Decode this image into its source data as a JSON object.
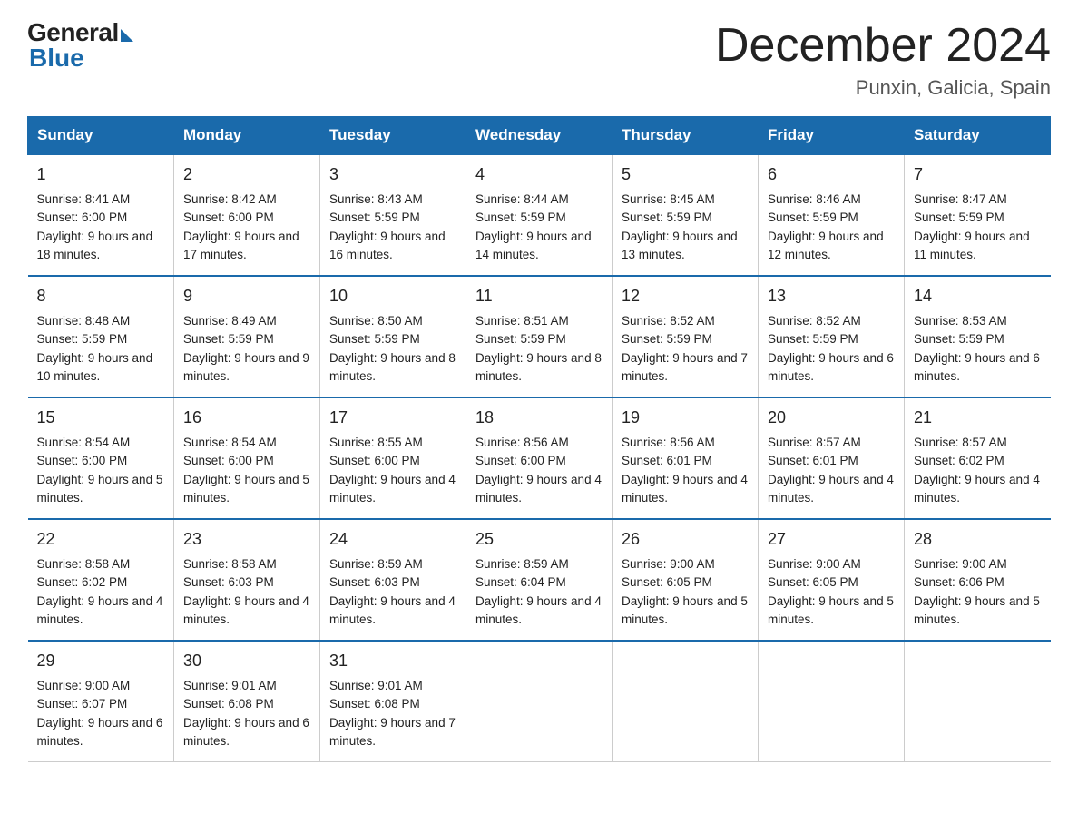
{
  "logo": {
    "general": "General",
    "blue": "Blue"
  },
  "header": {
    "title": "December 2024",
    "location": "Punxin, Galicia, Spain"
  },
  "days_header": [
    "Sunday",
    "Monday",
    "Tuesday",
    "Wednesday",
    "Thursday",
    "Friday",
    "Saturday"
  ],
  "weeks": [
    [
      {
        "day": "1",
        "sunrise": "8:41 AM",
        "sunset": "6:00 PM",
        "daylight": "9 hours and 18 minutes."
      },
      {
        "day": "2",
        "sunrise": "8:42 AM",
        "sunset": "6:00 PM",
        "daylight": "9 hours and 17 minutes."
      },
      {
        "day": "3",
        "sunrise": "8:43 AM",
        "sunset": "5:59 PM",
        "daylight": "9 hours and 16 minutes."
      },
      {
        "day": "4",
        "sunrise": "8:44 AM",
        "sunset": "5:59 PM",
        "daylight": "9 hours and 14 minutes."
      },
      {
        "day": "5",
        "sunrise": "8:45 AM",
        "sunset": "5:59 PM",
        "daylight": "9 hours and 13 minutes."
      },
      {
        "day": "6",
        "sunrise": "8:46 AM",
        "sunset": "5:59 PM",
        "daylight": "9 hours and 12 minutes."
      },
      {
        "day": "7",
        "sunrise": "8:47 AM",
        "sunset": "5:59 PM",
        "daylight": "9 hours and 11 minutes."
      }
    ],
    [
      {
        "day": "8",
        "sunrise": "8:48 AM",
        "sunset": "5:59 PM",
        "daylight": "9 hours and 10 minutes."
      },
      {
        "day": "9",
        "sunrise": "8:49 AM",
        "sunset": "5:59 PM",
        "daylight": "9 hours and 9 minutes."
      },
      {
        "day": "10",
        "sunrise": "8:50 AM",
        "sunset": "5:59 PM",
        "daylight": "9 hours and 8 minutes."
      },
      {
        "day": "11",
        "sunrise": "8:51 AM",
        "sunset": "5:59 PM",
        "daylight": "9 hours and 8 minutes."
      },
      {
        "day": "12",
        "sunrise": "8:52 AM",
        "sunset": "5:59 PM",
        "daylight": "9 hours and 7 minutes."
      },
      {
        "day": "13",
        "sunrise": "8:52 AM",
        "sunset": "5:59 PM",
        "daylight": "9 hours and 6 minutes."
      },
      {
        "day": "14",
        "sunrise": "8:53 AM",
        "sunset": "5:59 PM",
        "daylight": "9 hours and 6 minutes."
      }
    ],
    [
      {
        "day": "15",
        "sunrise": "8:54 AM",
        "sunset": "6:00 PM",
        "daylight": "9 hours and 5 minutes."
      },
      {
        "day": "16",
        "sunrise": "8:54 AM",
        "sunset": "6:00 PM",
        "daylight": "9 hours and 5 minutes."
      },
      {
        "day": "17",
        "sunrise": "8:55 AM",
        "sunset": "6:00 PM",
        "daylight": "9 hours and 4 minutes."
      },
      {
        "day": "18",
        "sunrise": "8:56 AM",
        "sunset": "6:00 PM",
        "daylight": "9 hours and 4 minutes."
      },
      {
        "day": "19",
        "sunrise": "8:56 AM",
        "sunset": "6:01 PM",
        "daylight": "9 hours and 4 minutes."
      },
      {
        "day": "20",
        "sunrise": "8:57 AM",
        "sunset": "6:01 PM",
        "daylight": "9 hours and 4 minutes."
      },
      {
        "day": "21",
        "sunrise": "8:57 AM",
        "sunset": "6:02 PM",
        "daylight": "9 hours and 4 minutes."
      }
    ],
    [
      {
        "day": "22",
        "sunrise": "8:58 AM",
        "sunset": "6:02 PM",
        "daylight": "9 hours and 4 minutes."
      },
      {
        "day": "23",
        "sunrise": "8:58 AM",
        "sunset": "6:03 PM",
        "daylight": "9 hours and 4 minutes."
      },
      {
        "day": "24",
        "sunrise": "8:59 AM",
        "sunset": "6:03 PM",
        "daylight": "9 hours and 4 minutes."
      },
      {
        "day": "25",
        "sunrise": "8:59 AM",
        "sunset": "6:04 PM",
        "daylight": "9 hours and 4 minutes."
      },
      {
        "day": "26",
        "sunrise": "9:00 AM",
        "sunset": "6:05 PM",
        "daylight": "9 hours and 5 minutes."
      },
      {
        "day": "27",
        "sunrise": "9:00 AM",
        "sunset": "6:05 PM",
        "daylight": "9 hours and 5 minutes."
      },
      {
        "day": "28",
        "sunrise": "9:00 AM",
        "sunset": "6:06 PM",
        "daylight": "9 hours and 5 minutes."
      }
    ],
    [
      {
        "day": "29",
        "sunrise": "9:00 AM",
        "sunset": "6:07 PM",
        "daylight": "9 hours and 6 minutes."
      },
      {
        "day": "30",
        "sunrise": "9:01 AM",
        "sunset": "6:08 PM",
        "daylight": "9 hours and 6 minutes."
      },
      {
        "day": "31",
        "sunrise": "9:01 AM",
        "sunset": "6:08 PM",
        "daylight": "9 hours and 7 minutes."
      },
      null,
      null,
      null,
      null
    ]
  ]
}
